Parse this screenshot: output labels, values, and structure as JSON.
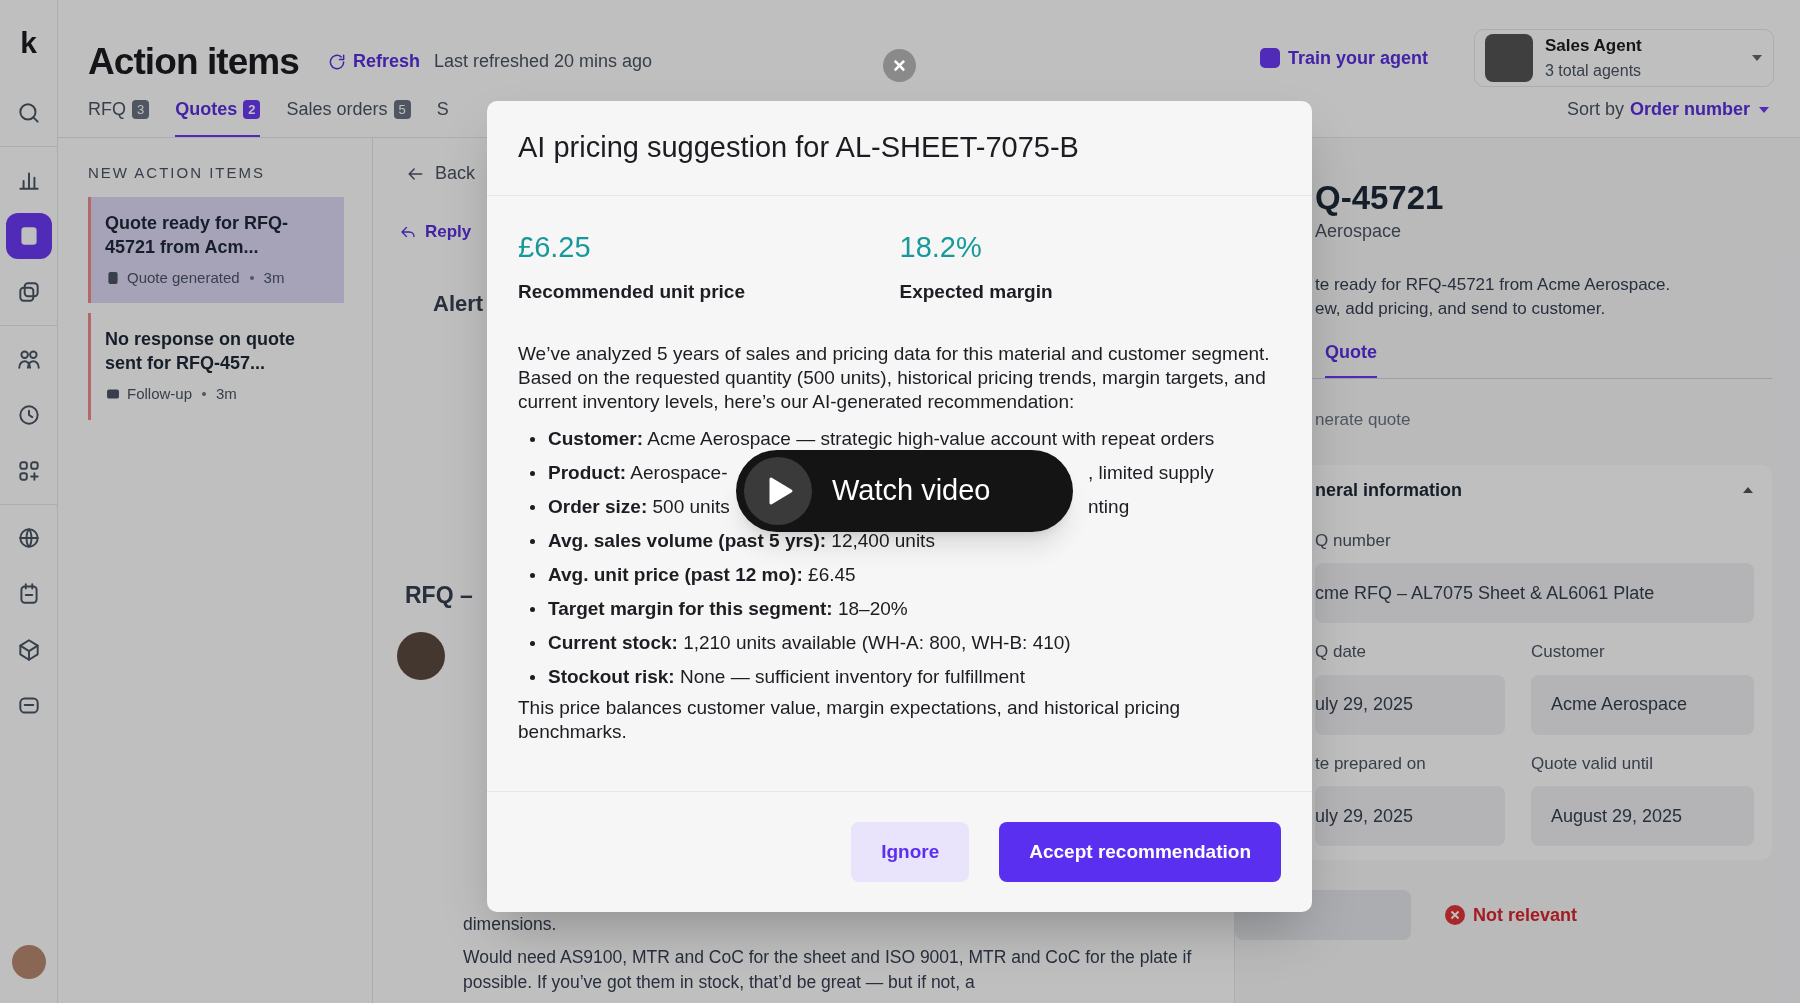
{
  "sidebar": {
    "logo": "k",
    "groups": [
      [
        {
          "kind": "search",
          "selected": false
        }
      ],
      [
        {
          "kind": "chart",
          "selected": false
        },
        {
          "kind": "document",
          "selected": true
        },
        {
          "kind": "layers",
          "selected": false
        }
      ],
      [
        {
          "kind": "people",
          "selected": false
        },
        {
          "kind": "clock",
          "selected": false
        },
        {
          "kind": "grid",
          "selected": false
        }
      ],
      [
        {
          "kind": "globe",
          "selected": false
        },
        {
          "kind": "calendar",
          "selected": false
        },
        {
          "kind": "box",
          "selected": false
        },
        {
          "kind": "chat",
          "selected": false
        }
      ]
    ]
  },
  "header": {
    "title": "Action items",
    "refresh": "Refresh",
    "last_refreshed": "Last refreshed 20 mins ago",
    "train_agent": "Train your agent",
    "agent": {
      "name": "Sales Agent",
      "subtitle": "3 total agents"
    }
  },
  "tabs": [
    {
      "label": "RFQ",
      "count": "3",
      "selected": false
    },
    {
      "label": "Quotes",
      "count": "2",
      "selected": true
    },
    {
      "label": "Sales orders",
      "count": "5",
      "selected": false
    },
    {
      "label": "S",
      "selected": false
    }
  ],
  "sort": {
    "label": "Sort by",
    "value": "Order number"
  },
  "action_list": {
    "heading": "NEW ACTION ITEMS",
    "items": [
      {
        "kind": "quote",
        "title": "Quote ready for RFQ-45721 from Acm...",
        "meta": "Quote generated",
        "time": "3m",
        "selected": true
      },
      {
        "kind": "follow_up",
        "title": "No response on quote sent for RFQ-457...",
        "meta": "Follow-up",
        "time": "3m",
        "selected": false
      }
    ]
  },
  "detail": {
    "back": "Back",
    "reply": "Reply",
    "alert_title": "Alert",
    "thread_title": "RFQ –",
    "message_tail": [
      "dimensions.",
      "Would need AS9100, MTR and CoC for the sheet and ISO 9001, MTR and CoC for the plate if possible. If you’ve got them in stock, that’d be great — but if not, a"
    ]
  },
  "quote_panel": {
    "title": "Q-45721",
    "subtitle": "Aerospace",
    "summary": [
      "te ready for RFQ-45721 from Acme Aerospace.",
      "ew, add pricing, and send to customer."
    ],
    "tab": "Quote",
    "generate": "nerate quote",
    "section": "neral information",
    "fields": [
      {
        "label": "Q number",
        "value": "cme RFQ – AL7075 Sheet & AL6061 Plate",
        "wide": true
      },
      {
        "label": "Q date",
        "value": "uly 29, 2025",
        "wide": false
      },
      {
        "label": "Customer",
        "value": "Acme Aerospace",
        "wide": false
      },
      {
        "label": "te prepared on",
        "value": "uly 29, 2025",
        "wide": false
      },
      {
        "label": "Quote valid until",
        "value": "August 29, 2025",
        "wide": false
      }
    ],
    "save_disabled": true,
    "not_relevant": "Not relevant"
  },
  "modal": {
    "close": "×",
    "title": "AI pricing suggestion for AL-SHEET-7075-B",
    "stats": [
      {
        "value": "£6.25",
        "label": "Recommended unit price"
      },
      {
        "value": "18.2%",
        "label": "Expected margin"
      }
    ],
    "intro": "We’ve analyzed 5 years of sales and pricing data for this material and customer segment. Based on the requested quantity (500 units), historical pricing trends, margin targets, and current inventory levels, here’s our AI-generated recommendation:",
    "bullets": [
      {
        "text": "**Customer:** Acme Aerospace — strategic high-value account with repeat orders"
      },
      {
        "text": "**Product:** Aerospace-",
        "after": ", limited supply"
      },
      {
        "text": "**Order size:** 500 units",
        "after": "nting"
      },
      {
        "text": "**Avg. sales volume (past 5 yrs):** 12,400 units"
      },
      {
        "text": "**Avg. unit price (past 12 mo):** £6.45"
      },
      {
        "text": "**Target margin for this segment:** 18–20%"
      },
      {
        "text": "**Current stock:** 1,210 units available (WH-A: 800, WH-B: 410)"
      },
      {
        "text": "**Stockout risk:** None — sufficient inventory for fulfillment"
      }
    ],
    "conclusion": "This price balances customer value, margin expectations, and historical pricing benchmarks.",
    "buttons": [
      {
        "kind": "secondary",
        "label": "Ignore"
      },
      {
        "kind": "primary",
        "label": "Accept recommendation"
      }
    ]
  },
  "video_button": {
    "label": "Watch video"
  }
}
